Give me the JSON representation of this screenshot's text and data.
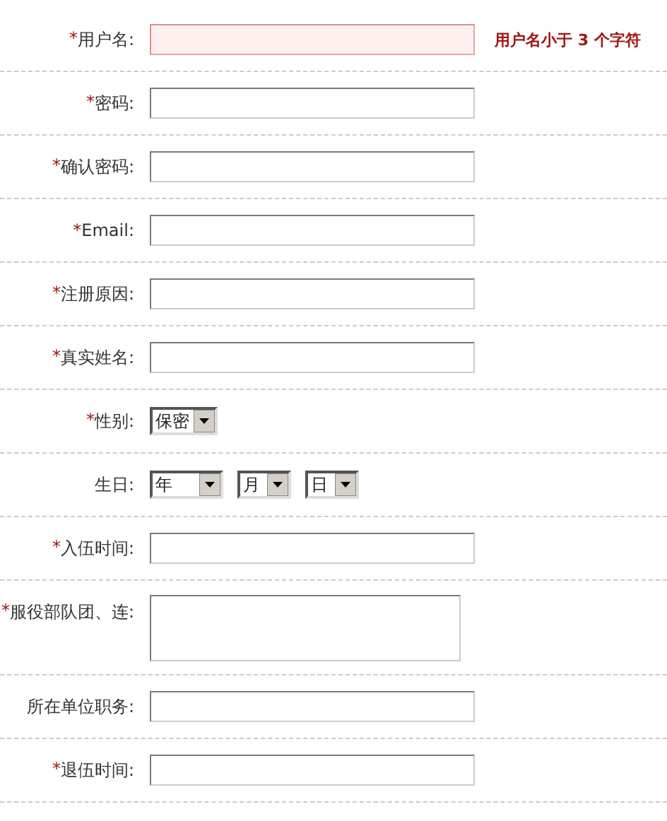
{
  "form": {
    "rows": [
      {
        "kind": "text",
        "mark": "*",
        "label": "用户名:",
        "invalid": true,
        "error": "用户名小于 3 个字符"
      },
      {
        "kind": "text",
        "mark": "*",
        "label": "密码:",
        "invalid": false
      },
      {
        "kind": "text",
        "mark": "*",
        "label": "确认密码:",
        "invalid": false
      },
      {
        "kind": "text",
        "mark": "*",
        "label": "Email:",
        "invalid": false
      },
      {
        "kind": "text",
        "mark": "*",
        "label": "注册原因:",
        "invalid": false
      },
      {
        "kind": "text",
        "mark": "*",
        "label": "真实姓名:",
        "invalid": false
      },
      {
        "kind": "select",
        "mark": "*",
        "label": "性别:",
        "selects": [
          {
            "value": "保密"
          }
        ]
      },
      {
        "kind": "select",
        "label": "生日:",
        "selects": [
          {
            "value": "年"
          },
          {
            "value": "月"
          },
          {
            "value": "日"
          }
        ]
      },
      {
        "kind": "text",
        "mark": "*",
        "label": "入伍时间:",
        "invalid": false
      },
      {
        "kind": "textarea",
        "mark": "*",
        "label": "服役部队团、连:",
        "invalid": false
      },
      {
        "kind": "text",
        "label": "所在单位职务:",
        "invalid": false
      },
      {
        "kind": "text",
        "mark": "*",
        "label": "退伍时间:",
        "invalid": false
      }
    ]
  }
}
